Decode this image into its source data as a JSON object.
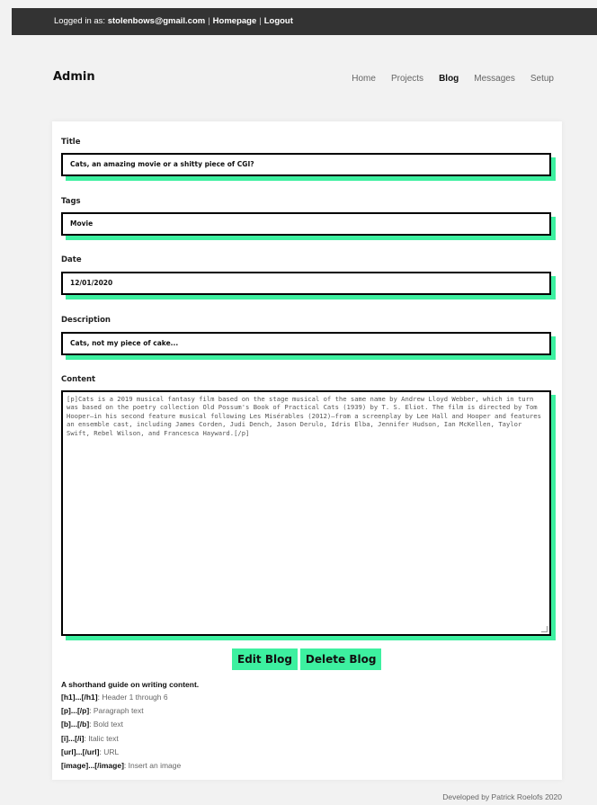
{
  "topbar": {
    "logged_in_prefix": "Logged in as: ",
    "email": "stolenbows@gmail.com",
    "homepage": "Homepage",
    "logout": "Logout",
    "separator": "|"
  },
  "brand": "Admin",
  "nav": {
    "home": "Home",
    "projects": "Projects",
    "blog": "Blog",
    "messages": "Messages",
    "setup": "Setup"
  },
  "form": {
    "title_label": "Title",
    "title_value": "Cats, an amazing movie or a shitty piece of CGI?",
    "tags_label": "Tags",
    "tags_value": "Movie",
    "date_label": "Date",
    "date_value": "12/01/2020",
    "description_label": "Description",
    "description_value": "Cats, not my piece of cake...",
    "content_label": "Content",
    "content_value": "[p]Cats is a 2019 musical fantasy film based on the stage musical of the same name by Andrew Lloyd Webber, which in turn was based on the poetry collection Old Possum's Book of Practical Cats (1939) by T. S. Eliot. The film is directed by Tom Hooper—in his second feature musical following Les Misérables (2012)—from a screenplay by Lee Hall and Hooper and features an ensemble cast, including James Corden, Judi Dench, Jason Derulo, Idris Elba, Jennifer Hudson, Ian McKellen, Taylor Swift, Rebel Wilson, and Francesca Hayward.[/p]"
  },
  "buttons": {
    "edit": "Edit Blog",
    "delete": "Delete Blog"
  },
  "guide": {
    "title": "A shorthand guide on writing content.",
    "items": [
      {
        "code": "[h1]...[/h1]",
        "desc": "Header 1 through 6"
      },
      {
        "code": "[p]...[/p]",
        "desc": "Paragraph text"
      },
      {
        "code": "[b]...[/b]",
        "desc": "Bold text"
      },
      {
        "code": "[i]...[/i]",
        "desc": "Italic text"
      },
      {
        "code": "[url]...[/url]",
        "desc": "URL"
      },
      {
        "code": "[image]...[/image]",
        "desc": "Insert an image"
      }
    ]
  },
  "footer": "Developed by Patrick Roelofs 2020",
  "colors": {
    "accent": "#3df0a0",
    "topbar": "#333333"
  }
}
